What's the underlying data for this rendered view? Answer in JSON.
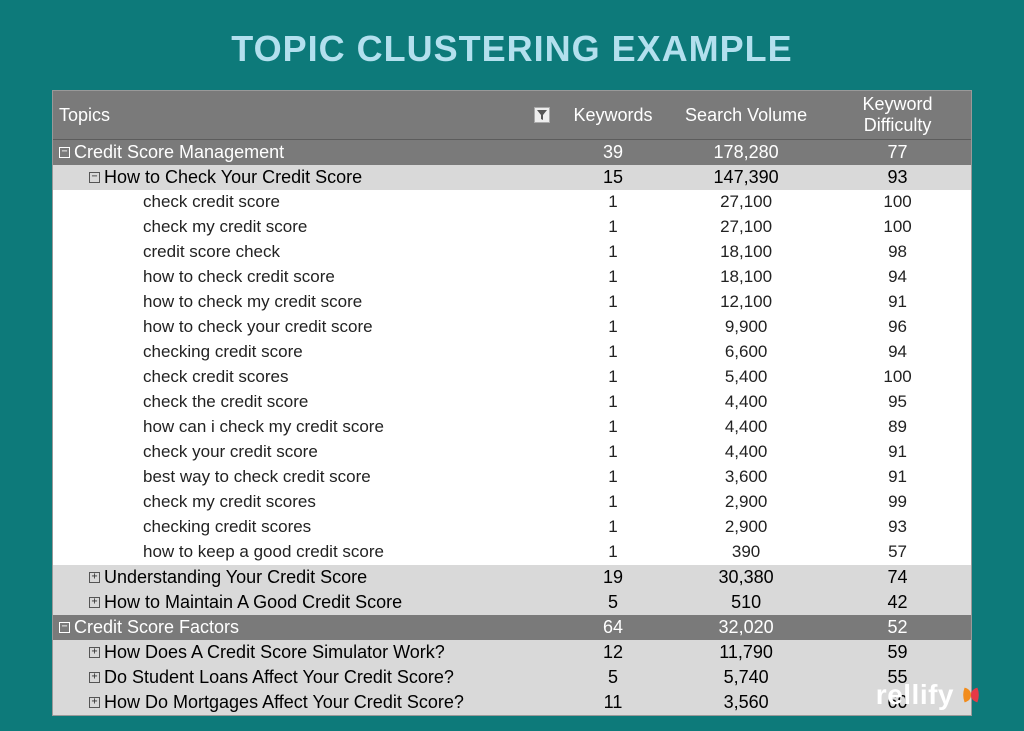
{
  "title": "TOPIC CLUSTERING EXAMPLE",
  "logo_text": "rellify",
  "columns": {
    "topics": "Topics",
    "keywords": "Keywords",
    "search_volume": "Search Volume",
    "keyword_difficulty": "Keyword Difficulty"
  },
  "rows": [
    {
      "level": 0,
      "expanded": true,
      "topic": "Credit Score Management",
      "keywords": "39",
      "search_volume": "178,280",
      "difficulty": "77"
    },
    {
      "level": 1,
      "expanded": true,
      "topic": "How to Check Your Credit Score",
      "keywords": "15",
      "search_volume": "147,390",
      "difficulty": "93"
    },
    {
      "level": 2,
      "topic": "check credit score",
      "keywords": "1",
      "search_volume": "27,100",
      "difficulty": "100"
    },
    {
      "level": 2,
      "topic": "check my credit score",
      "keywords": "1",
      "search_volume": "27,100",
      "difficulty": "100"
    },
    {
      "level": 2,
      "topic": "credit score check",
      "keywords": "1",
      "search_volume": "18,100",
      "difficulty": "98"
    },
    {
      "level": 2,
      "topic": "how to check credit score",
      "keywords": "1",
      "search_volume": "18,100",
      "difficulty": "94"
    },
    {
      "level": 2,
      "topic": "how to check my credit score",
      "keywords": "1",
      "search_volume": "12,100",
      "difficulty": "91"
    },
    {
      "level": 2,
      "topic": "how to check your credit score",
      "keywords": "1",
      "search_volume": "9,900",
      "difficulty": "96"
    },
    {
      "level": 2,
      "topic": "checking credit score",
      "keywords": "1",
      "search_volume": "6,600",
      "difficulty": "94"
    },
    {
      "level": 2,
      "topic": "check credit scores",
      "keywords": "1",
      "search_volume": "5,400",
      "difficulty": "100"
    },
    {
      "level": 2,
      "topic": "check the credit score",
      "keywords": "1",
      "search_volume": "4,400",
      "difficulty": "95"
    },
    {
      "level": 2,
      "topic": "how can i check my credit score",
      "keywords": "1",
      "search_volume": "4,400",
      "difficulty": "89"
    },
    {
      "level": 2,
      "topic": "check your credit score",
      "keywords": "1",
      "search_volume": "4,400",
      "difficulty": "91"
    },
    {
      "level": 2,
      "topic": "best way to check credit score",
      "keywords": "1",
      "search_volume": "3,600",
      "difficulty": "91"
    },
    {
      "level": 2,
      "topic": "check my credit scores",
      "keywords": "1",
      "search_volume": "2,900",
      "difficulty": "99"
    },
    {
      "level": 2,
      "topic": "checking credit scores",
      "keywords": "1",
      "search_volume": "2,900",
      "difficulty": "93"
    },
    {
      "level": 2,
      "topic": "how to keep a good credit score",
      "keywords": "1",
      "search_volume": "390",
      "difficulty": "57"
    },
    {
      "level": 1,
      "expanded": false,
      "topic": "Understanding Your Credit Score",
      "keywords": "19",
      "search_volume": "30,380",
      "difficulty": "74"
    },
    {
      "level": 1,
      "expanded": false,
      "topic": "How to Maintain A Good Credit Score",
      "keywords": "5",
      "search_volume": "510",
      "difficulty": "42"
    },
    {
      "level": 0,
      "expanded": true,
      "topic": "Credit Score Factors",
      "keywords": "64",
      "search_volume": "32,020",
      "difficulty": "52"
    },
    {
      "level": 1,
      "expanded": false,
      "topic": "How Does A Credit Score Simulator Work?",
      "keywords": "12",
      "search_volume": "11,790",
      "difficulty": "59"
    },
    {
      "level": 1,
      "expanded": false,
      "topic": "Do Student Loans Affect Your Credit Score?",
      "keywords": "5",
      "search_volume": "5,740",
      "difficulty": "55"
    },
    {
      "level": 1,
      "expanded": false,
      "topic": "How Do Mortgages Affect Your Credit Score?",
      "keywords": "11",
      "search_volume": "3,560",
      "difficulty": "60"
    }
  ]
}
